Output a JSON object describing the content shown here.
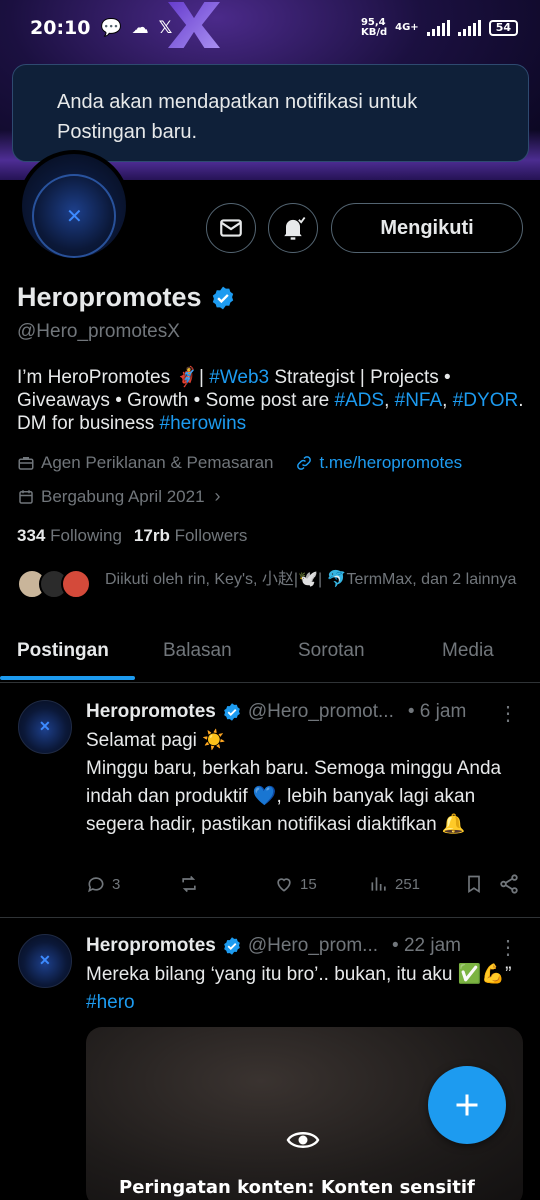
{
  "status_bar": {
    "time": "20:10",
    "network_speed": "95,4",
    "network_unit": "KB/d",
    "network_type": "4G+",
    "battery": "54"
  },
  "toast": {
    "text": "Anda akan mendapatkan notifikasi untuk Postingan baru."
  },
  "profile": {
    "follow_button": "Mengikuti",
    "name": "Heropromotes",
    "handle": "@Hero_promotesX",
    "bio": {
      "p1": "I’m HeroPromotes 🦸| ",
      "t1": "#Web3",
      "p2": " Strategist | Projects • Giveaways • Growth • Some post are ",
      "t2": "#ADS",
      "p3": ", ",
      "t3": "#NFA",
      "p4": ", ",
      "t4": "#DYOR",
      "p5": ". DM for business ",
      "t5": "#herowins"
    },
    "category": "Agen Periklanan & Pemasaran",
    "link": "t.me/heropromotes",
    "joined": "Bergabung April 2021",
    "following_count": "334",
    "following_label": "Following",
    "followers_count": "17rb",
    "followers_label": "Followers",
    "followed_by": "Diikuti oleh rin, Key's, 小赵|🕊️| 🐬TermMax, dan 2 lainnya"
  },
  "tabs": [
    {
      "label": "Postingan"
    },
    {
      "label": "Balasan"
    },
    {
      "label": "Sorotan"
    },
    {
      "label": "Media"
    }
  ],
  "posts": [
    {
      "name": "Heropromotes",
      "handle": "@Hero_promot...",
      "time": "• 6 jam",
      "text_line1": "Selamat pagi ☀️",
      "text_line2": "Minggu baru, berkah baru. Semoga minggu Anda indah dan produktif 💙, lebih banyak lagi akan segera hadir, pastikan notifikasi diaktifkan 🔔",
      "replies": "3",
      "likes": "15",
      "views": "251"
    },
    {
      "name": "Heropromotes",
      "handle": "@Hero_prom...",
      "time": "• 22 jam",
      "text_a": "Mereka bilang ‘yang itu bro’.. bukan, itu aku ✅💪” ",
      "text_tag": "#hero",
      "media_warning": "Peringatan konten: Konten sensitif"
    }
  ],
  "colors": {
    "accent": "#1d9bf0",
    "background": "#000000",
    "muted_text": "#71767b",
    "primary_text": "#e7e9ea",
    "toast_bg": "#0f2039"
  }
}
